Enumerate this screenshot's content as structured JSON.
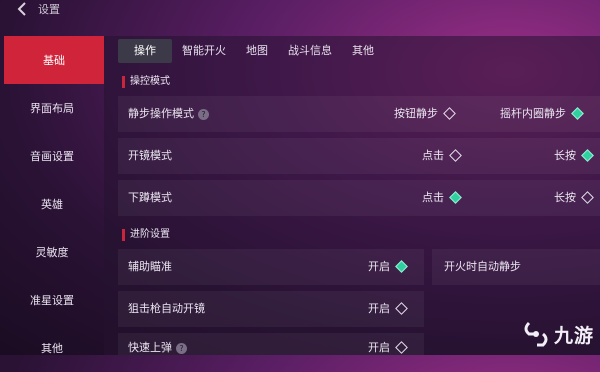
{
  "header": {
    "back_icon": "chevron-left-icon",
    "title": "设置"
  },
  "sidebar": {
    "items": [
      {
        "label": "基础",
        "active": true
      },
      {
        "label": "界面布局"
      },
      {
        "label": "音画设置"
      },
      {
        "label": "英雄"
      },
      {
        "label": "灵敏度"
      },
      {
        "label": "准星设置"
      },
      {
        "label": "其他"
      }
    ]
  },
  "tabs": [
    {
      "label": "操作",
      "active": true
    },
    {
      "label": "智能开火"
    },
    {
      "label": "地图"
    },
    {
      "label": "战斗信息"
    },
    {
      "label": "其他"
    }
  ],
  "sections": {
    "control_mode": {
      "title": "操控模式",
      "rows": {
        "silent_step": {
          "label": "静步操作模式",
          "options": [
            {
              "label": "按钮静步",
              "checked": false
            },
            {
              "label": "摇杆内圈静步",
              "checked": true
            }
          ]
        },
        "scope": {
          "label": "开镜模式",
          "options": [
            {
              "label": "点击",
              "checked": false
            },
            {
              "label": "长按",
              "checked": true
            }
          ]
        },
        "crouch": {
          "label": "下蹲模式",
          "options": [
            {
              "label": "点击",
              "checked": true
            },
            {
              "label": "长按",
              "checked": false
            }
          ]
        }
      }
    },
    "advanced": {
      "title": "进阶设置",
      "rows": {
        "aim_assist": {
          "label": "辅助瞄准",
          "value": "开启",
          "checked": true
        },
        "fire_auto_silent": {
          "label": "开火时自动静步"
        },
        "sniper_auto_scope": {
          "label": "狙击枪自动开镜",
          "value": "开启",
          "checked": false
        },
        "quick_reload": {
          "label": "快速上弹",
          "value": "开启"
        }
      }
    }
  },
  "watermark": {
    "text": "九游"
  },
  "colors": {
    "accent_red": "#d0243a",
    "check_green": "#2fcfa0"
  }
}
